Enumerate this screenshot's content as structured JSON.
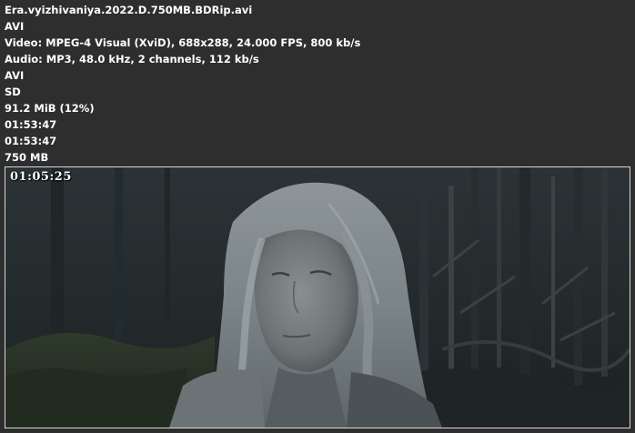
{
  "media_info": {
    "filename": "Era.vyizhivaniya.2022.D.750MB.BDRip.avi",
    "container": "AVI",
    "video": "Video: MPEG-4 Visual (XviD), 688x288, 24.000 FPS, 800 kb/s",
    "audio": "Audio: MP3, 48.0 kHz, 2 channels, 112 kb/s",
    "format": "AVI",
    "quality": "SD",
    "size": "91.2 MiB (12%)",
    "duration": "01:53:47",
    "duration_repeat": "01:53:47",
    "target_size": "750 MB"
  },
  "frame": {
    "timecode": "01:05:25"
  },
  "colors": {
    "background": "#2e2e2e",
    "text": "#ffffff",
    "frame_border": "#d8d8d8"
  }
}
